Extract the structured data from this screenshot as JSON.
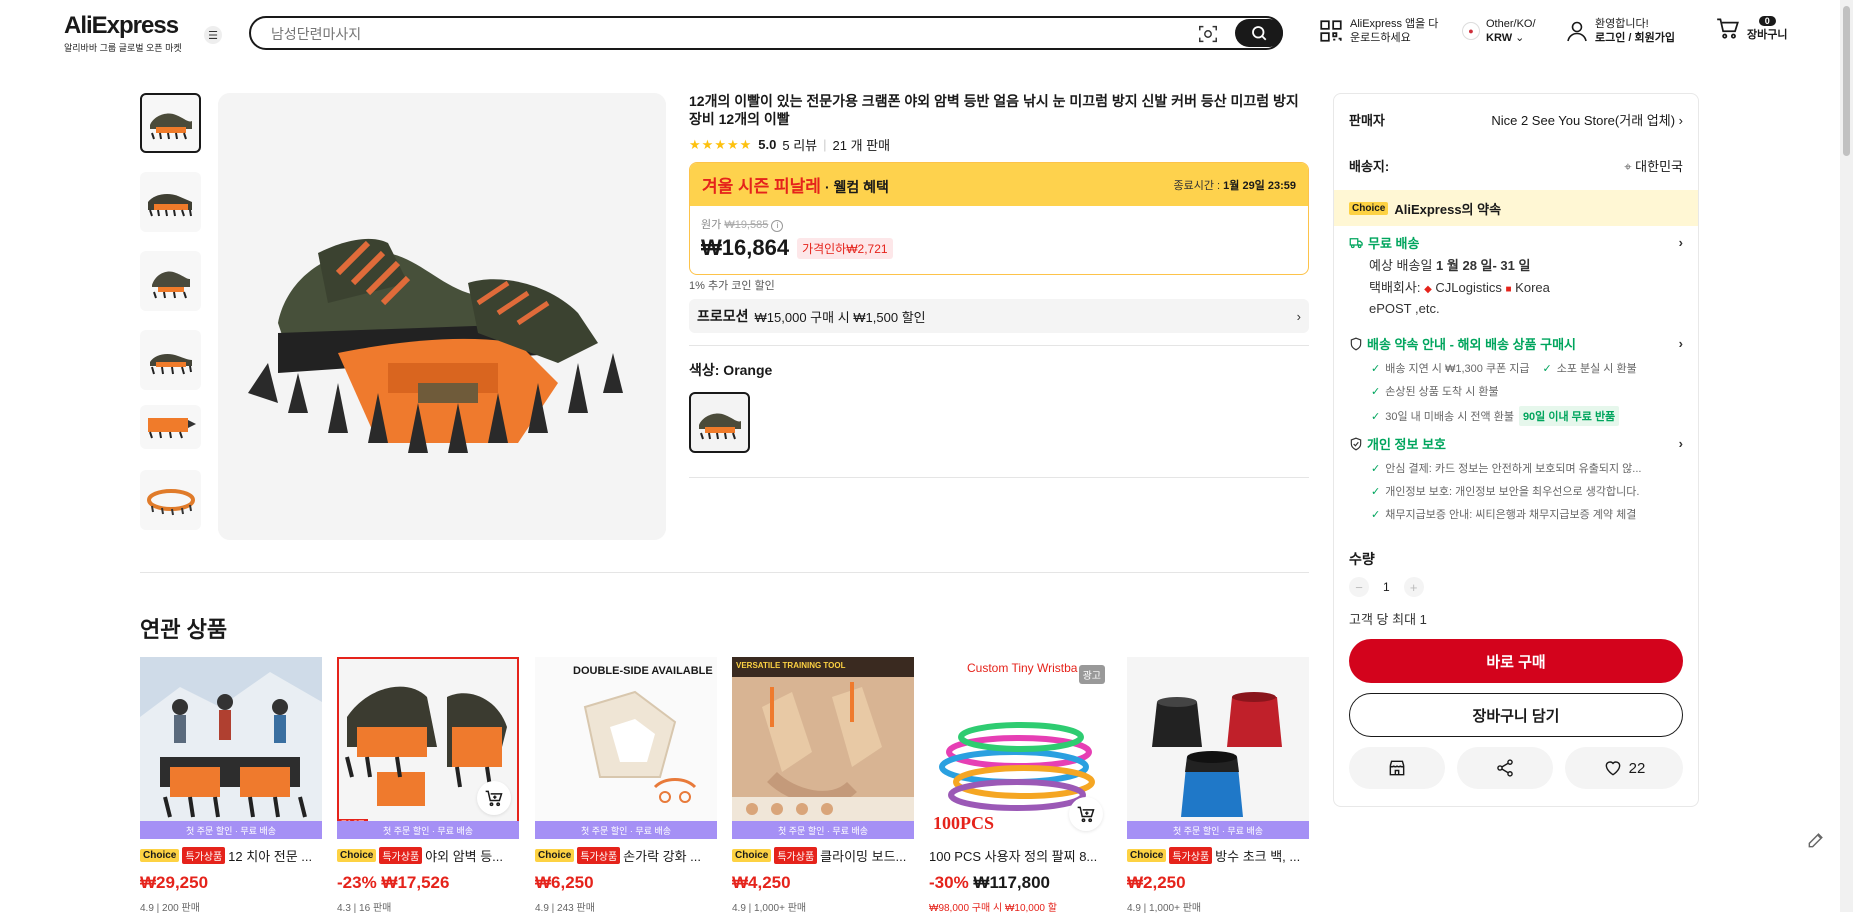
{
  "header": {
    "logo": "AliExpress",
    "logo_sub": "알리바바 그룹 글로벌 오픈 마켓",
    "search_placeholder": "남성단련마사지",
    "app_line1": "AliExpress 앱을 다",
    "app_line2": "운로드하세요",
    "region_line1": "Other/KO/",
    "region_line2": "KRW",
    "account_line1": "환영합니다!",
    "account_line2": "로그인 / 회원가입",
    "cart_count": "0",
    "cart_label": "장바구니"
  },
  "product": {
    "title": "12개의 이빨이 있는 전문가용 크램폰 야외 암벽 등반 얼음 낚시 눈 미끄럼 방지 신발 커버 등산 미끄럼 방지 장비 12개의 이빨",
    "rating": "5.0",
    "reviews": "5 리뷰",
    "sold": "21 개 판매",
    "sale_name": "겨울 시즌 피날레",
    "sale_sub": "· 웰컴 혜택",
    "sale_end_label": "종료시간 :",
    "sale_end_value": "1월 29일 23:59",
    "orig_label": "원가",
    "orig_price": "₩19,585",
    "price": "₩16,864",
    "discount": "가격인하₩2,721",
    "coin_note": "1% 추가 코인 할인",
    "promo_label": "프로모션",
    "promo_text": "₩15,000 구매 시 ₩1,500 할인",
    "color_label": "색상: Orange"
  },
  "related": {
    "title": "연관 상품",
    "items": [
      {
        "band": "첫 주문 할인 · 무료 배송",
        "choice": "Choice",
        "deal": "특가상품",
        "name": "12 치아 전문 ...",
        "price": "₩29,250",
        "pct": "",
        "stat": "4.9 | 200 판매"
      },
      {
        "band": "첫 주문 할인 · 무료 배송",
        "choice": "Choice",
        "deal": "특가상품",
        "name": "야외 암벽 등...",
        "price": "₩17,526",
        "pct": "-23%",
        "stat": "4.3 | 16 판매"
      },
      {
        "band": "첫 주문 할인 · 무료 배송",
        "choice": "Choice",
        "deal": "특가상품",
        "name": "손가락 강화 ...",
        "price": "₩6,250",
        "pct": "",
        "stat": "4.9 | 243 판매",
        "img_text": "DOUBLE-SIDE AVAILABLE"
      },
      {
        "band": "첫 주문 할인 · 무료 배송",
        "choice": "Choice",
        "deal": "특가상품",
        "name": "클라이밍 보드...",
        "price": "₩4,250",
        "pct": "",
        "stat": "4.9 | 1,000+ 판매",
        "img_text": "VERSATILE TRAINING TOOL"
      },
      {
        "band": "",
        "choice": "",
        "deal": "",
        "name": "100 PCS 사용자 정의 팔찌 8...",
        "price": "₩117,800",
        "pct": "-30%",
        "stat": "₩98,000 구매 시 ₩10,000 할",
        "img_text": "Custom Tiny Wristba",
        "img_text2": "100PCS",
        "ad": "광고"
      },
      {
        "band": "첫 주문 할인 · 무료 배송",
        "choice": "Choice",
        "deal": "특가상품",
        "name": "방수 초크 백, ...",
        "price": "₩2,250",
        "pct": "",
        "stat": "4.9 | 1,000+ 판매"
      }
    ]
  },
  "sidebar": {
    "seller_label": "판매자",
    "seller_value": "Nice 2 See You Store(거래 업체)",
    "ship_label": "배송지:",
    "ship_value": "대한민국",
    "choice_tag": "Choice",
    "promise": "AliExpress의 약속",
    "free_ship": "무료 배송",
    "eta_label": "예상 배송일",
    "eta_value": "1 월 28 일- 31 일",
    "courier_label": "택배회사:",
    "courier_1": "CJLogistics",
    "courier_2": "Korea",
    "courier_3": "ePOST ,etc.",
    "guarantee_title": "배송 약속 안내 - 해외 배송 상품 구매시",
    "g1": "배송 지연 시 ₩1,300 쿠폰 지급",
    "g2": "소포 분실 시 환불",
    "g3": "손상된 상품 도착 시 환불",
    "g4": "30일 내 미배송 시 전액 환불",
    "g4_badge": "90일 이내 무료 반품",
    "privacy_title": "개인 정보 보호",
    "p1": "안심 결제: 카드 정보는 안전하게 보호되며 유출되지 않...",
    "p2": "개인정보 보호: 개인정보 보안을 최우선으로 생각합니다.",
    "p3": "채무지급보증 안내: 씨티은행과 채무지급보증 계약 체결",
    "qty_label": "수량",
    "qty_value": "1",
    "limit": "고객 당 최대 1",
    "buy_now": "바로 구매",
    "add_cart": "장바구니 담기",
    "wish_count": "22"
  },
  "colors": {
    "accent": "#d3031c",
    "sale_yellow": "#fed24d",
    "green": "#00a55d",
    "band": "#a590f5"
  }
}
